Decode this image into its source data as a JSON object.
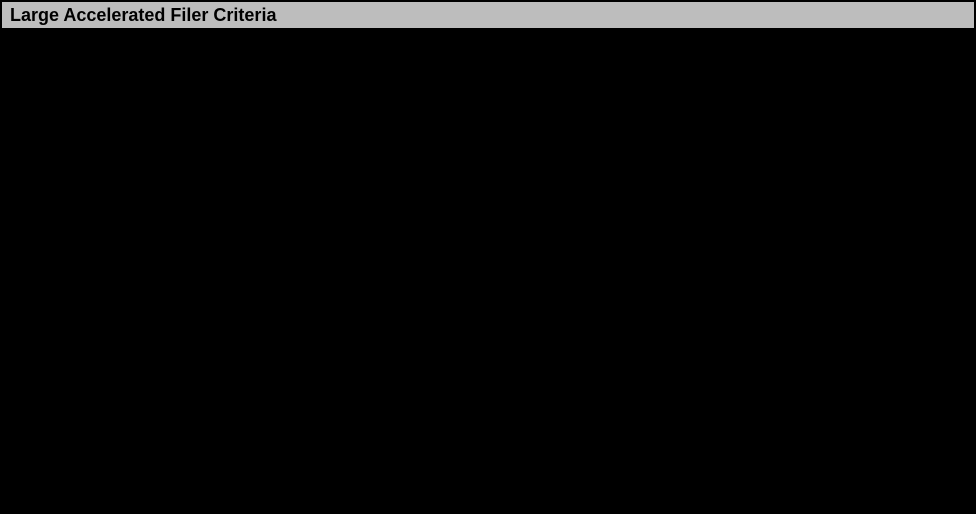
{
  "header": {
    "title": "Large Accelerated Filer Criteria"
  }
}
